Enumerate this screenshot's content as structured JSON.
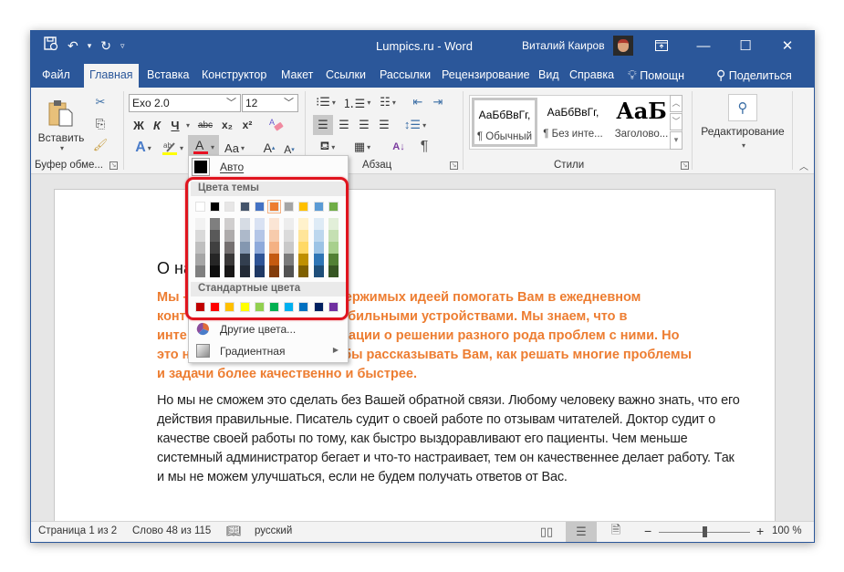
{
  "window": {
    "title": "Lumpics.ru  -  Word",
    "user_name": "Виталий Каиров",
    "controls": {
      "ribbon_display": "ribbon-display-icon",
      "minimize": "—",
      "maximize": "☐",
      "close": "✕"
    }
  },
  "quick_access": {
    "save": "autosave-icon",
    "undo": "↶",
    "redo": "↻",
    "customize": "▿"
  },
  "tabs": [
    {
      "label": "Файл"
    },
    {
      "label": "Главная",
      "active": true
    },
    {
      "label": "Вставка"
    },
    {
      "label": "Конструктор"
    },
    {
      "label": "Макет"
    },
    {
      "label": "Ссылки"
    },
    {
      "label": "Рассылки"
    },
    {
      "label": "Рецензирование"
    },
    {
      "label": "Вид"
    },
    {
      "label": "Справка"
    },
    {
      "label": "Помощн"
    },
    {
      "label": "Поделиться"
    }
  ],
  "ribbon": {
    "clipboard": {
      "paste_label": "Вставить",
      "group_label": "Буфер обме..."
    },
    "font": {
      "font_name": "Exo 2.0",
      "font_size": "12",
      "bold": "Ж",
      "italic": "К",
      "underline": "Ч",
      "strike": "abc",
      "subscript": "x₂",
      "superscript": "x²",
      "text_effects": "A",
      "case": "Aa",
      "grow": "A",
      "shrink": "A",
      "font_color_accent": "#e81123",
      "highlight_accent": "#ffff00"
    },
    "paragraph": {
      "group_label": "Абзац",
      "pilcrow": "¶"
    },
    "styles": {
      "group_label": "Стили",
      "items": [
        {
          "sample": "АаБбВвГг,",
          "name": "¶ Обычный",
          "selected": true
        },
        {
          "sample": "АаБбВвГг,",
          "name": "¶ Без инте..."
        },
        {
          "sample": "АаБ",
          "name": "Заголово..."
        }
      ]
    },
    "editing": {
      "label": "Редактирование"
    }
  },
  "document": {
    "heading": "О на",
    "paragraph_orange": "Мы –                           держимых идеей помогать Вам в ежедневном конт                           мобильными устройствами. Мы знаем, что в инте                           омации о решении разного рода проблем с ними. Но это н                          тобы рассказывать Вам, как решать многие проблемы и задачи более качественно и быстрее.",
    "paragraph_orange_lines": [
      "Мы –",
      "держимых идеей помогать Вам в ежедневном",
      "конт",
      "мобильными устройствами. Мы знаем, что в",
      "инте",
      "омации о решении разного рода проблем с ними. Но",
      "это н",
      "тобы рассказывать Вам, как решать многие проблемы",
      "и задачи более качественно и быстрее."
    ],
    "paragraph_black": "Но мы не сможем это сделать без Вашей обратной связи. Любому человеку важно знать, что его действия правильные. Писатель судит о своей работе по отзывам читателей. Доктор судит о качестве своей работы по тому, как быстро выздоравливают его пациенты. Чем меньше системный администратор бегает и что-то настраивает, тем он качественнее делает работу. Так и мы не можем улучшаться, если не будем получать ответов от Вас."
  },
  "color_menu": {
    "auto_label": "Авто",
    "auto_color": "#000000",
    "theme_title": "Цвета темы",
    "theme_colors": [
      "#ffffff",
      "#000000",
      "#e7e6e6",
      "#44546a",
      "#4472c4",
      "#ed7d31",
      "#a5a5a5",
      "#ffc000",
      "#5b9bd5",
      "#70ad47"
    ],
    "selected_theme_color": "#ed7d31",
    "theme_shades": [
      [
        "#f2f2f2",
        "#d9d9d9",
        "#bfbfbf",
        "#a6a6a6",
        "#808080"
      ],
      [
        "#7f7f7f",
        "#595959",
        "#404040",
        "#262626",
        "#0d0d0d"
      ],
      [
        "#d0cece",
        "#aeabab",
        "#757070",
        "#3a3838",
        "#171616"
      ],
      [
        "#d6dce4",
        "#adb9ca",
        "#8497b0",
        "#333f4f",
        "#222a35"
      ],
      [
        "#d9e2f3",
        "#b4c6e7",
        "#8eaadb",
        "#2f5496",
        "#1f3864"
      ],
      [
        "#fbe5d5",
        "#f7cbac",
        "#f4b183",
        "#c55a11",
        "#833c0b"
      ],
      [
        "#ededed",
        "#dbdbdb",
        "#c9c9c9",
        "#7b7b7b",
        "#525252"
      ],
      [
        "#fff2cc",
        "#ffe599",
        "#ffd965",
        "#bf9000",
        "#7f6000"
      ],
      [
        "#deebf6",
        "#bdd7ee",
        "#9cc3e5",
        "#2e75b5",
        "#1e4e79"
      ],
      [
        "#e2efd9",
        "#c5e0b3",
        "#a8d08d",
        "#538135",
        "#375623"
      ]
    ],
    "standard_title": "Стандартные цвета",
    "standard_colors": [
      "#c00000",
      "#ff0000",
      "#ffc000",
      "#ffff00",
      "#92d050",
      "#00b050",
      "#00b0f0",
      "#0070c0",
      "#002060",
      "#7030a0"
    ],
    "more_colors_label": "Другие цвета...",
    "gradient_label": "Градиентная",
    "highlight_color": "#e0141e"
  },
  "status_bar": {
    "page": "Страница 1 из 2",
    "words": "Слово 48 из 115",
    "language": "русский",
    "zoom": "100 %",
    "zoom_minus": "−",
    "zoom_plus": "+",
    "zoom_level_percent": 100
  }
}
